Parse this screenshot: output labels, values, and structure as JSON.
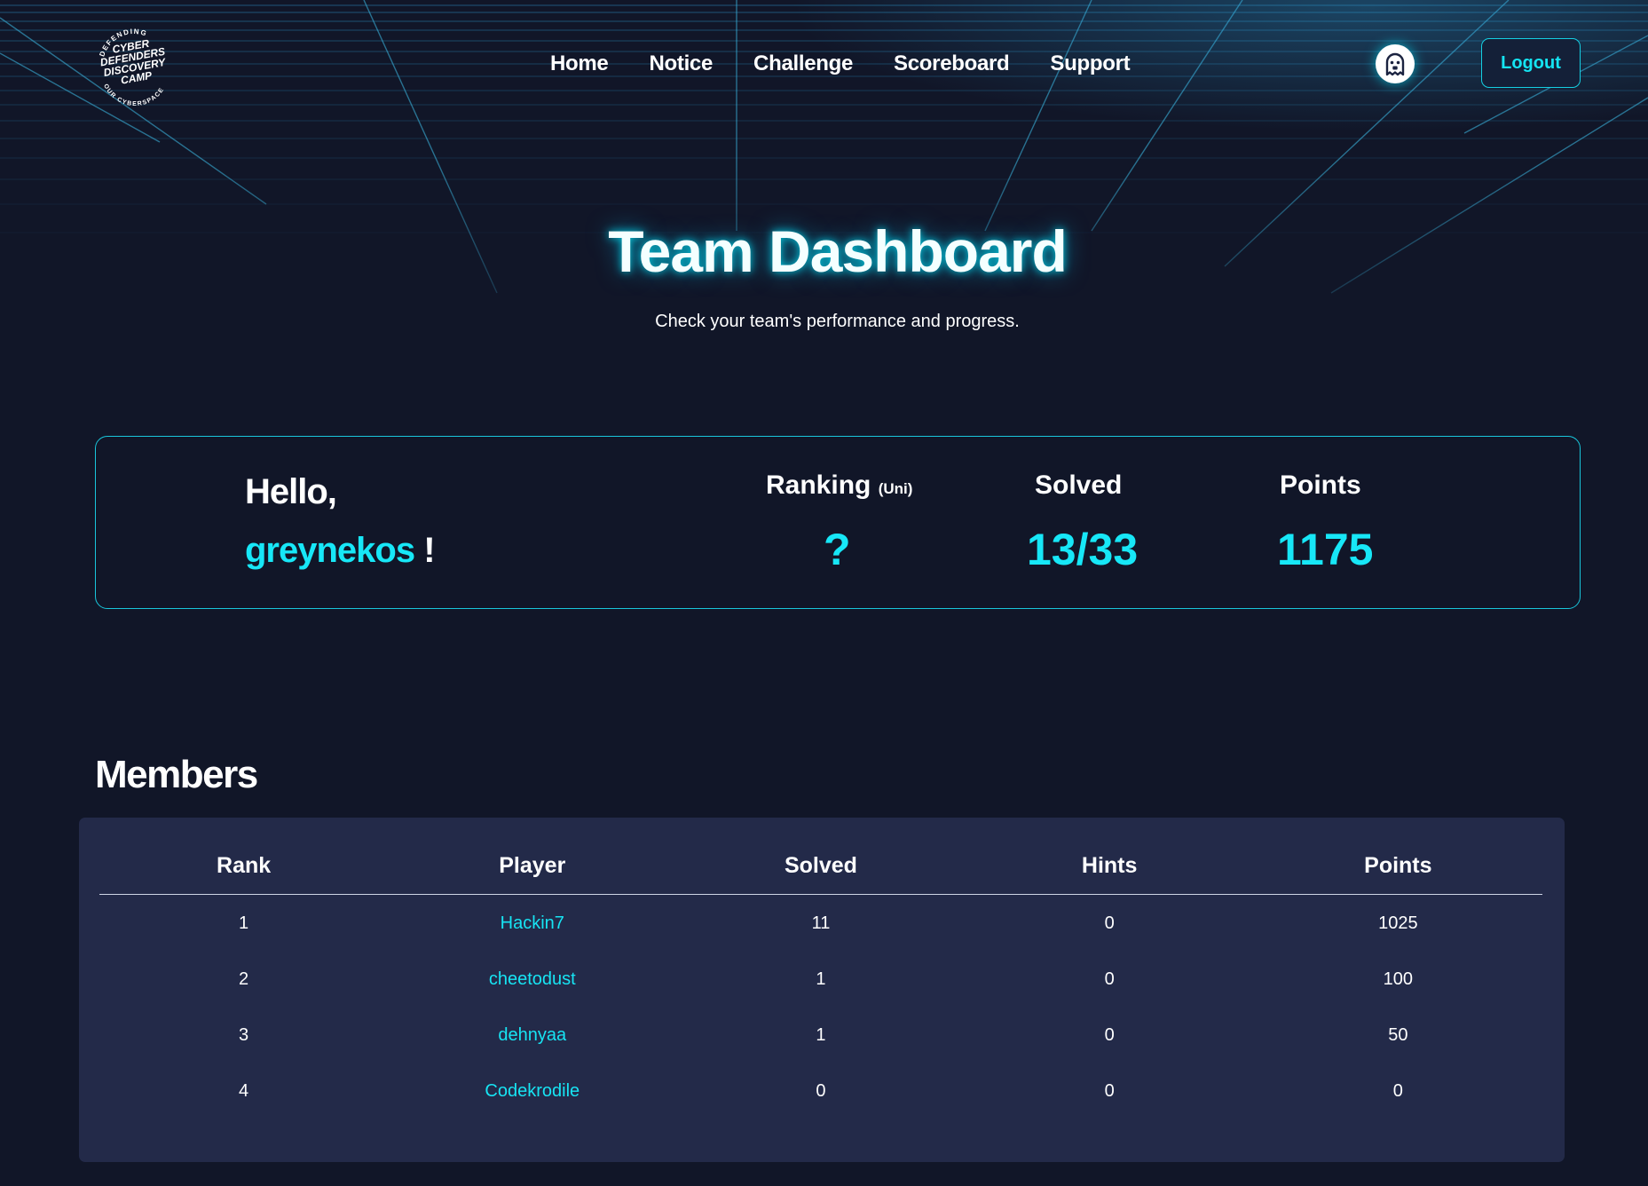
{
  "header": {
    "logo": {
      "icon": "cyber-defenders-discovery-camp-logo",
      "lines": [
        "CYBER",
        "DEFENDERS",
        "DISCOVERY",
        "CAMP"
      ],
      "ring_top": "DEFENDING",
      "ring_bottom": "OUR CYBERSPACE"
    },
    "nav": [
      "Home",
      "Notice",
      "Challenge",
      "Scoreboard",
      "Support"
    ],
    "avatar_icon": "ghost-icon",
    "logout_label": "Logout"
  },
  "hero": {
    "title": "Team Dashboard",
    "subtitle": "Check your team's performance and progress."
  },
  "stats": {
    "greeting": "Hello,",
    "username": "greynekos",
    "exclaim": "!",
    "ranking_label": "Ranking",
    "ranking_suffix": "(Uni)",
    "ranking_value": "?",
    "solved_label": "Solved",
    "solved_value": "13/33",
    "points_label": "Points",
    "points_value": "1175"
  },
  "members": {
    "title": "Members",
    "columns": [
      "Rank",
      "Player",
      "Solved",
      "Hints",
      "Points"
    ],
    "rows": [
      {
        "rank": "1",
        "player": "Hackin7",
        "solved": "11",
        "hints": "0",
        "points": "1025"
      },
      {
        "rank": "2",
        "player": "cheetodust",
        "solved": "1",
        "hints": "0",
        "points": "100"
      },
      {
        "rank": "3",
        "player": "dehnyaa",
        "solved": "1",
        "hints": "0",
        "points": "50"
      },
      {
        "rank": "4",
        "player": "Codekrodile",
        "solved": "0",
        "hints": "0",
        "points": "0"
      }
    ]
  },
  "colors": {
    "background": "#111628",
    "accent": "#17e7f7",
    "table_bg": "#232a49",
    "grid_line": "#2a8ec0"
  }
}
